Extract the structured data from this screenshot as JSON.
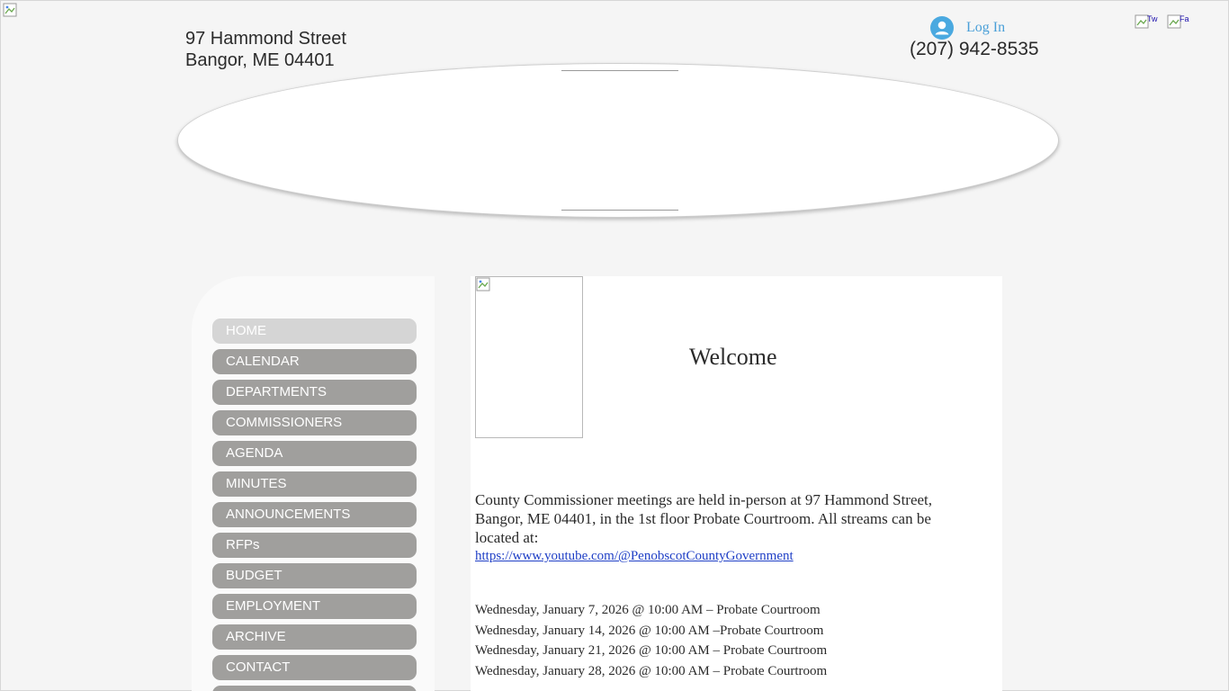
{
  "header": {
    "address_line1": "97 Hammond Street",
    "address_line2": "Bangor, ME 04401",
    "login_label": "Log In",
    "phone": "(207) 942-8535",
    "social": [
      {
        "alt": "Tw",
        "icon": "twitter-icon"
      },
      {
        "alt": "Fa",
        "icon": "facebook-icon"
      }
    ]
  },
  "nav": {
    "items": [
      {
        "label": "HOME",
        "active": true
      },
      {
        "label": "CALENDAR"
      },
      {
        "label": "DEPARTMENTS"
      },
      {
        "label": "COMMISSIONERS"
      },
      {
        "label": "AGENDA"
      },
      {
        "label": "MINUTES"
      },
      {
        "label": "ANNOUNCEMENTS"
      },
      {
        "label": "RFPs"
      },
      {
        "label": "BUDGET"
      },
      {
        "label": "EMPLOYMENT"
      },
      {
        "label": "ARCHIVE"
      },
      {
        "label": "CONTACT"
      },
      {
        "label": ""
      }
    ]
  },
  "main": {
    "title": "Welcome",
    "intro": "County Commissioner meetings are held in-person at 97 Hammond Street, Bangor, ME 04401, in the 1st floor Probate Courtroom. All streams can be located at:",
    "link": "https://www.youtube.com/@PenobscotCountyGovernment",
    "meetings": [
      "Wednesday, January 7, 2026 @ 10:00 AM – Probate Courtroom",
      "Wednesday, January 14, 2026 @ 10:00 AM –Probate Courtroom",
      "Wednesday, January 21, 2026 @ 10:00 AM – Probate Courtroom",
      "Wednesday, January 28, 2026 @ 10:00 AM – Probate Courtroom"
    ]
  },
  "colors": {
    "nav_bg": "#a09f9d",
    "nav_active_bg": "#d5d5d5",
    "link": "#1f3fc6",
    "login": "#4a9fd8"
  }
}
